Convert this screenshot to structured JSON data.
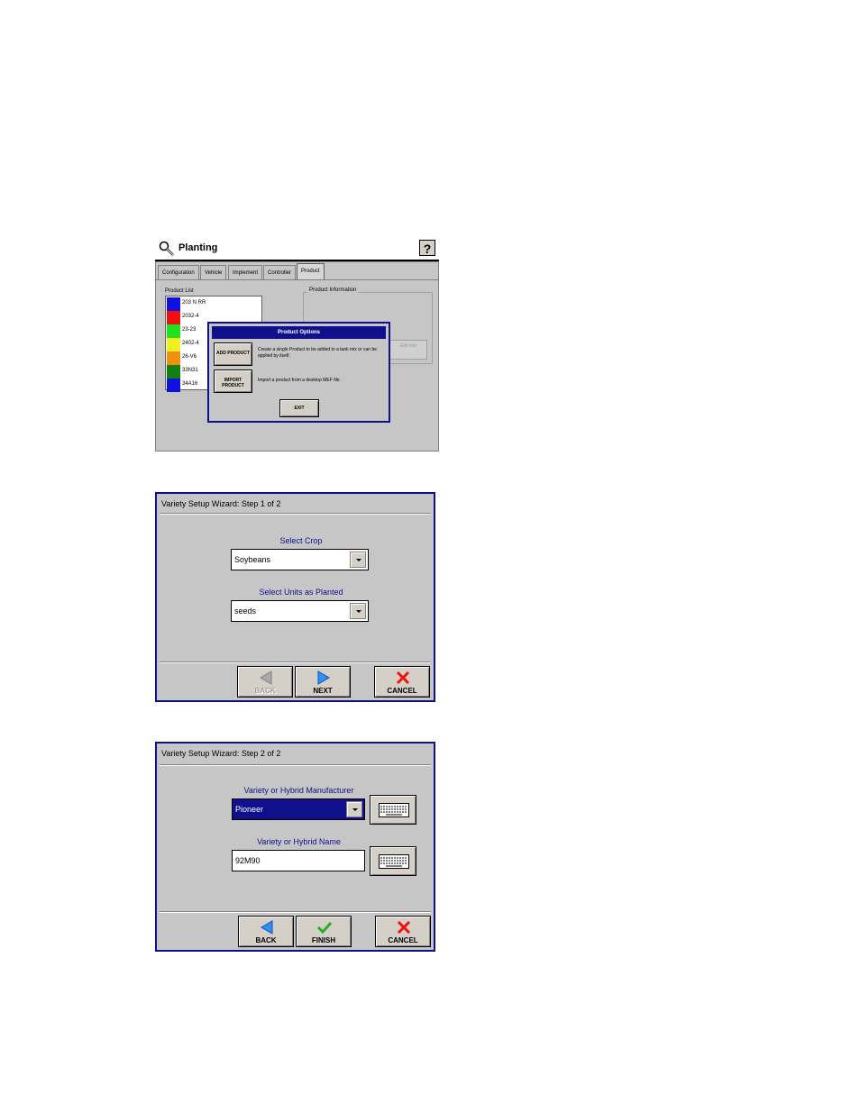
{
  "planting": {
    "title": "Planting",
    "help_label": "?",
    "tabs": [
      "Configuration",
      "Vehicle",
      "Implement",
      "Controller",
      "Product"
    ],
    "active_tab": "Product",
    "product_list_label": "Product List",
    "products": [
      {
        "name": "203 N RR",
        "color": "#1010e0"
      },
      {
        "name": "2032-4",
        "color": "#f01010"
      },
      {
        "name": "23-23",
        "color": "#20e020"
      },
      {
        "name": "2402-4",
        "color": "#f0f020"
      },
      {
        "name": "26-V6",
        "color": "#f09010"
      },
      {
        "name": "33N31",
        "color": "#108010"
      },
      {
        "name": "34A16",
        "color": "#1010e0"
      }
    ],
    "product_info_label": "Product Information",
    "product_info_button": "Edit Info",
    "product_options": {
      "title": "Product Options",
      "add_button": "ADD PRODUCT",
      "add_desc": "Create a single Product to be added to a tank mix or can be applied by itself.",
      "import_button": "IMPORT PRODUCT",
      "import_desc": "Import a product from a desktop MEF file.",
      "exit_button": "EXIT"
    }
  },
  "wizard1": {
    "title": "Variety Setup Wizard:  Step 1 of 2",
    "crop_label": "Select Crop",
    "crop_value": "Soybeans",
    "units_label": "Select Units as Planted",
    "units_value": "seeds",
    "back": "BACK",
    "next": "NEXT",
    "cancel": "CANCEL"
  },
  "wizard2": {
    "title": "Variety Setup Wizard:  Step 2 of 2",
    "manufacturer_label": "Variety or Hybrid Manufacturer",
    "manufacturer_value": "Pioneer",
    "name_label": "Variety or Hybrid Name",
    "name_value": "92M90",
    "back": "BACK",
    "finish": "FINISH",
    "cancel": "CANCEL"
  }
}
